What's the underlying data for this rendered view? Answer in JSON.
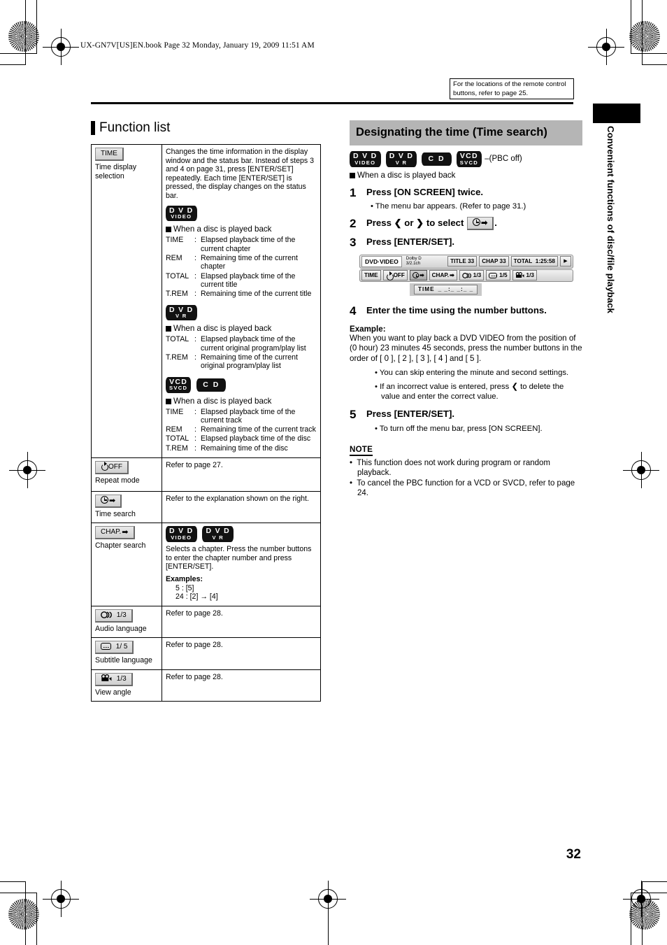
{
  "page": {
    "file_header": "UX-GN7V[US]EN.book  Page 32  Monday, January 19, 2009  11:51 AM",
    "page_number": "32",
    "running_head": "Convenient functions of disc/file playback",
    "remote_note": "For the locations of the remote control buttons, refer to page 25."
  },
  "left": {
    "section_title": "Function list",
    "rows": [
      {
        "chip": "TIME",
        "label": "Time display selection",
        "body_intro": "Changes the time information in the display window and the status bar. Instead of steps 3 and 4 on page 31, press [ENTER/SET] repeatedly. Each time [ENTER/SET] is pressed, the display changes on the status bar.",
        "blocks": [
          {
            "discs": [
              {
                "l1": "D V D",
                "l2": "VIDEO"
              }
            ],
            "when": "When a disc is played back",
            "defs": [
              {
                "k": "TIME",
                "v": "Elapsed playback time of the current chapter"
              },
              {
                "k": "REM",
                "v": "Remaining time of the current chapter"
              },
              {
                "k": "TOTAL",
                "v": "Elapsed playback time of the current title"
              },
              {
                "k": "T.REM",
                "v": "Remaining time of the current title"
              }
            ]
          },
          {
            "discs": [
              {
                "l1": "D V D",
                "l2": "V R"
              }
            ],
            "when": "When a disc is played back",
            "defs": [
              {
                "k": "TOTAL",
                "v": "Elapsed playback time of the current original program/play list"
              },
              {
                "k": "T.REM",
                "v": "Remaining time of the current original program/play list"
              }
            ]
          },
          {
            "discs": [
              {
                "l1": "VCD",
                "l2": "SVCD"
              },
              {
                "l1": "C D",
                "l2": ""
              }
            ],
            "when": "When a disc is played back",
            "defs": [
              {
                "k": "TIME",
                "v": "Elapsed playback time of the current track"
              },
              {
                "k": "REM",
                "v": "Remaining time of the current track"
              },
              {
                "k": "TOTAL",
                "v": "Elapsed playback time of the disc"
              },
              {
                "k": "T.REM",
                "v": "Remaining time of the disc"
              }
            ]
          }
        ]
      },
      {
        "chip": "OFF",
        "chip_icon": "repeat-icon",
        "label": "Repeat mode",
        "body_intro": "Refer to page 27."
      },
      {
        "chip": "",
        "chip_icon": "clock-arrow-icon",
        "label": "Time search",
        "body_intro": "Refer to the explanation shown on the right."
      },
      {
        "chip": "CHAP.",
        "chip_icon": "chapter-arrow-icon",
        "label": "Chapter search",
        "discs": [
          {
            "l1": "D V D",
            "l2": "VIDEO"
          },
          {
            "l1": "D V D",
            "l2": "V R"
          }
        ],
        "body_intro": "Selects a chapter. Press the number buttons to enter the chapter number and press [ENTER/SET].",
        "examples_title": "Examples:",
        "examples": [
          "5 : [5]",
          "24 : [2] → [4]"
        ]
      },
      {
        "chip": "1/3",
        "chip_icon": "audio-icon",
        "label": "Audio language",
        "body_intro": "Refer to page 28."
      },
      {
        "chip": "1/ 5",
        "chip_icon": "subtitle-icon",
        "label": "Subtitle language",
        "body_intro": "Refer to page 28."
      },
      {
        "chip": "1/3",
        "chip_icon": "camera-angle-icon",
        "label": "View angle",
        "body_intro": "Refer to page 28."
      }
    ]
  },
  "right": {
    "heading": "Designating the time (Time search)",
    "discs": [
      {
        "l1": "D V D",
        "l2": "VIDEO"
      },
      {
        "l1": "D V D",
        "l2": "V R"
      },
      {
        "l1": "C D",
        "l2": ""
      },
      {
        "l1": "VCD",
        "l2": "SVCD"
      }
    ],
    "pbc_note": "(PBC off)",
    "when": "When a disc is played back",
    "steps": [
      {
        "num": "1",
        "text": "Press [ON SCREEN] twice.",
        "subs": [
          "The menu bar appears. (Refer to page 31.)"
        ]
      },
      {
        "num": "2",
        "text_pre": "Press ❮ or ❯ to select",
        "text_post": ".",
        "subs": []
      },
      {
        "num": "3",
        "text": "Press [ENTER/SET].",
        "subs": []
      },
      {
        "num": "4",
        "text": "Enter the time using the number buttons.",
        "subs": []
      },
      {
        "num": "5",
        "text": "Press [ENTER/SET].",
        "subs": [
          "To turn off the menu bar, press [ON SCREEN]."
        ]
      }
    ],
    "example_title": "Example:",
    "example_body": "When you want to play back a DVD VIDEO from the position of (0 hour) 23 minutes 45 seconds, press the number buttons in the order of [ 0 ], [ 2 ], [ 3 ], [ 4 ] and [ 5 ].",
    "step4_subs": [
      "You can skip entering the minute and second settings.",
      "If an incorrect value is entered, press ❮ to delete the value and enter the correct value."
    ],
    "osd": {
      "disc_label": "DVD·VIDEO",
      "audio_format_line1": "Dolby D",
      "audio_format_line2": "3/2.1ch",
      "title": "TITLE 33",
      "chapter": "CHAP 33",
      "total_label": "TOTAL",
      "total_value": "1:25:58",
      "play_icon": "▶",
      "toolbar": [
        {
          "label": "TIME",
          "icon": ""
        },
        {
          "label": "OFF",
          "icon": "repeat-icon"
        },
        {
          "label": "",
          "icon": "clock-arrow-icon",
          "selected": true
        },
        {
          "label": "CHAP.",
          "icon": "chapter-arrow-icon"
        },
        {
          "label": "1/3",
          "icon": "audio-icon"
        },
        {
          "label": "1/5",
          "icon": "subtitle-icon"
        },
        {
          "label": "1/3",
          "icon": "camera-angle-icon"
        }
      ],
      "time_entry_label": "TIME",
      "time_entry_value": "_ _:_ _:_ _"
    },
    "note_title": "NOTE",
    "notes": [
      "This function does not work during program or random playback.",
      "To cancel the PBC function for a VCD or SVCD, refer to page 24."
    ]
  }
}
